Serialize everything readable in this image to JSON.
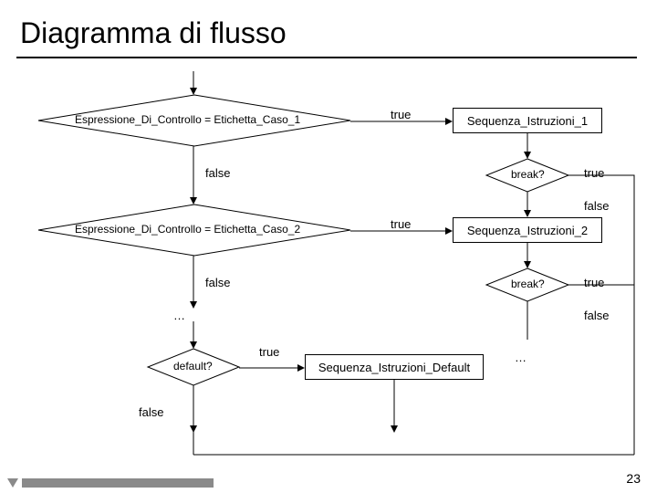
{
  "title": "Diagramma di flusso",
  "page_number": "23",
  "labels": {
    "true": "true",
    "false": "false",
    "ellipsis": "…"
  },
  "nodes": {
    "cond1": "Espressione_Di_Controllo = Etichetta_Caso_1",
    "cond2": "Espressione_Di_Controllo = Etichetta_Caso_2",
    "cond_default": "default?",
    "break": "break?",
    "seq1": "Sequenza_Istruzioni_1",
    "seq2": "Sequenza_Istruzioni_2",
    "seq_default": "Sequenza_Istruzioni_Default"
  }
}
